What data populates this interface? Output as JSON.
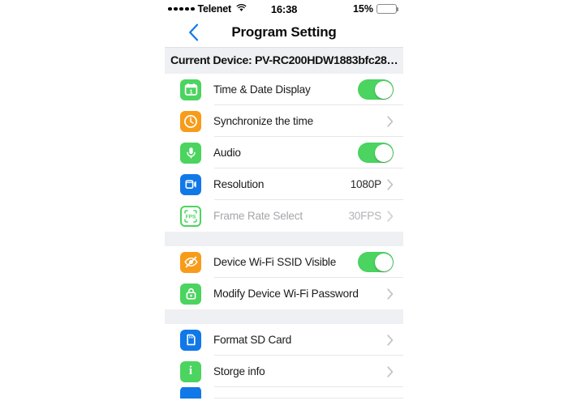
{
  "status_bar": {
    "signal_dots": 5,
    "carrier": "Telenet",
    "wifi_icon": "wifi-icon",
    "time": "16:38",
    "battery_percent": "15%",
    "battery_level": 15,
    "battery_color": "#FCCB2F"
  },
  "nav": {
    "back_icon": "chevron-left-icon",
    "back_color": "#1178E8",
    "title": "Program Setting"
  },
  "device_banner": {
    "text": "Current Device: PV-RC200HDW1883bfc28…"
  },
  "sections": [
    {
      "rows": [
        {
          "label": "Time & Date Display",
          "icon": "calendar-icon",
          "icon_style": "green",
          "control": "toggle",
          "toggle_on": true
        },
        {
          "label": "Synchronize the time",
          "icon": "clock-icon",
          "icon_style": "orange",
          "control": "chevron"
        },
        {
          "label": "Audio",
          "icon": "microphone-icon",
          "icon_style": "green",
          "control": "toggle",
          "toggle_on": true
        },
        {
          "label": "Resolution",
          "icon": "video-camera-icon",
          "icon_style": "blue",
          "control": "value-chevron",
          "value": "1080P"
        },
        {
          "label": "Frame Rate Select",
          "icon": "fps-icon",
          "icon_style": "hollow-green",
          "control": "value-chevron",
          "value": "30FPS",
          "disabled": true
        }
      ]
    },
    {
      "rows": [
        {
          "label": "Device Wi-Fi SSID Visible",
          "icon": "eye-slash-icon",
          "icon_style": "orange",
          "control": "toggle",
          "toggle_on": true
        },
        {
          "label": "Modify Device Wi-Fi Password",
          "icon": "lock-icon",
          "icon_style": "green",
          "control": "chevron"
        }
      ]
    },
    {
      "rows": [
        {
          "label": "Format SD Card",
          "icon": "sd-card-icon",
          "icon_style": "blue",
          "control": "chevron"
        },
        {
          "label": "Storge info",
          "icon": "info-icon",
          "icon_style": "green",
          "control": "chevron"
        }
      ]
    }
  ],
  "colors": {
    "green": "#4BD45F",
    "orange": "#F79C1A",
    "blue": "#1178E8",
    "separator": "#e6e6e9",
    "group_gap": "#eff0f3"
  }
}
